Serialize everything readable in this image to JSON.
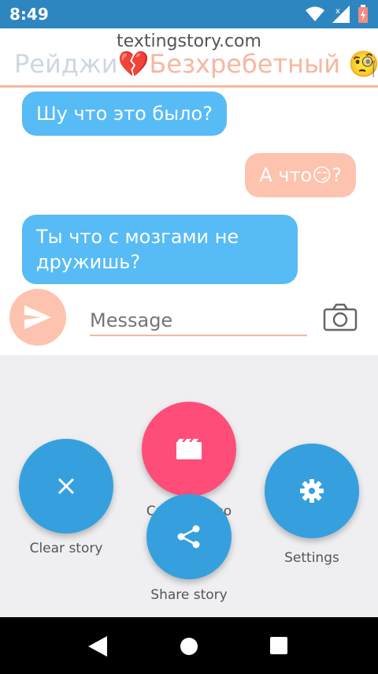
{
  "status": {
    "time": "8:49"
  },
  "header": {
    "watermark": "textingstory.com",
    "title_name1": "Рейджи",
    "title_name2": "Безхребетный",
    "emoji_heart": "💔",
    "emoji_monocle": "🧐"
  },
  "messages": [
    {
      "side": "in",
      "text": "Шу что это было?"
    },
    {
      "side": "out",
      "text": "А что😏?"
    },
    {
      "side": "in",
      "text": "Ты что с мозгами не дружишь?"
    }
  ],
  "composer": {
    "placeholder": "Message"
  },
  "actions": {
    "clear": "Clear story",
    "create_video": "Create video",
    "share": "Share story",
    "settings": "Settings"
  },
  "colors": {
    "accent_peach": "#FDC3AE",
    "incoming_blue": "#57BBF6",
    "fab_blue": "#36A0DE",
    "fab_pink": "#FF4D7A"
  }
}
